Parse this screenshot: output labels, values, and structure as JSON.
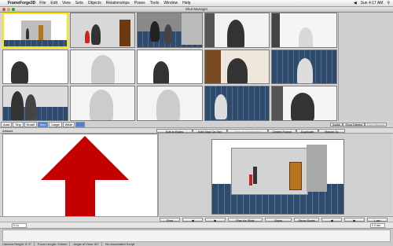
{
  "menubar": {
    "app": "FrameForge3D",
    "items": [
      "File",
      "Edit",
      "View",
      "Sets",
      "Objects",
      "Relationships",
      "Poses",
      "Tools",
      "Window",
      "Help"
    ],
    "clock": "Sun 4:17 AM"
  },
  "window": {
    "title": "Shot Manager"
  },
  "view_tabs": [
    "Auto",
    "Tiny",
    "Small",
    "Med",
    "Large",
    "Wide"
  ],
  "view_tab_active": "Med",
  "toolbar": {
    "pane_label": "Artwork",
    "buttons": [
      "Edit in Rules Program",
      "Edit Shot On Set",
      "Add as Continuing Shot",
      "Delete Frame",
      "Duplicate",
      "Return To Set"
    ],
    "right_buttons": [
      "Switch",
      "Show Deleted",
      "Print Selected"
    ]
  },
  "bottom_buttons": [
    "First Shot",
    "◀",
    "▶",
    "Play As Slide Show",
    "Show Blueprint",
    "Show Script",
    "◀",
    "▶",
    "Last Shot"
  ],
  "clip": {
    "left_value": "0 Lo",
    "right_value": "0 0 sec"
  },
  "status": [
    "Camera Height: 5' 0\"",
    "Focal Length: 9.8mm",
    "Angle of View: 61°",
    "No Associated Script"
  ],
  "colors": {
    "arrow": "#c50000",
    "selection": "#ffe600",
    "floor": "#2f4a6a"
  }
}
